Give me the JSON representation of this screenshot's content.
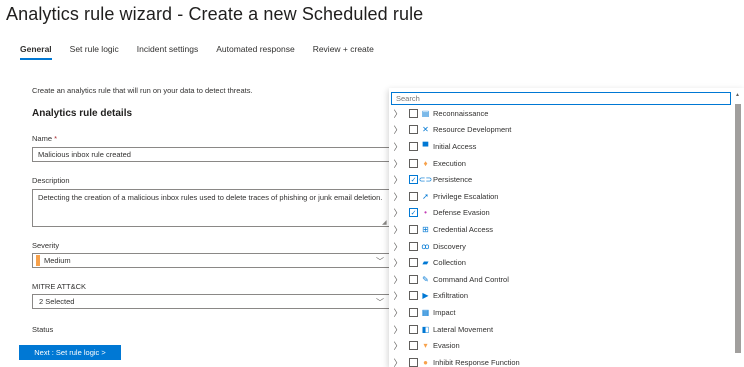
{
  "page": {
    "title": "Analytics rule wizard - Create a new Scheduled rule",
    "more": "···"
  },
  "tabs": [
    "General",
    "Set rule logic",
    "Incident settings",
    "Automated response",
    "Review + create"
  ],
  "form": {
    "intro": "Create an analytics rule that will run on your data to detect threats.",
    "section_title": "Analytics rule details",
    "name_label": "Name",
    "required_mark": "*",
    "name_value": "Malicious inbox rule created",
    "description_label": "Description",
    "description_value": "Detecting the creation of a malicious inbox rules used to delete traces of phishing or junk email deletion.",
    "severity_label": "Severity",
    "severity_value": "Medium",
    "mitre_label": "MITRE ATT&CK",
    "mitre_value": "2 Selected",
    "status_label": "Status",
    "next_button": "Next : Set rule logic >"
  },
  "dropdown": {
    "search_placeholder": "Search",
    "items": [
      {
        "label": "Reconnaissance",
        "checked": false,
        "icon": "reconnaissance-icon",
        "glyph": "▤",
        "color": "#0078d4"
      },
      {
        "label": "Resource Development",
        "checked": false,
        "icon": "resource-development-icon",
        "glyph": "✕",
        "color": "#0078d4"
      },
      {
        "label": "Initial Access",
        "checked": false,
        "icon": "initial-access-icon",
        "glyph": "▀",
        "color": "#0078d4"
      },
      {
        "label": "Execution",
        "checked": false,
        "icon": "execution-icon",
        "glyph": "♦",
        "color": "#f7a14b"
      },
      {
        "label": "Persistence",
        "checked": true,
        "icon": "persistence-icon",
        "glyph": "⊂⊃",
        "color": "#0078d4"
      },
      {
        "label": "Privilege Escalation",
        "checked": false,
        "icon": "privilege-escalation-icon",
        "glyph": "➚",
        "color": "#0078d4"
      },
      {
        "label": "Defense Evasion",
        "checked": true,
        "icon": "defense-evasion-icon",
        "glyph": "•",
        "color": "#c239b3"
      },
      {
        "label": "Credential Access",
        "checked": false,
        "icon": "credential-access-icon",
        "glyph": "⊞",
        "color": "#0078d4"
      },
      {
        "label": "Discovery",
        "checked": false,
        "icon": "discovery-icon",
        "glyph": "ꝏ",
        "color": "#0078d4"
      },
      {
        "label": "Collection",
        "checked": false,
        "icon": "collection-icon",
        "glyph": "▰",
        "color": "#0078d4"
      },
      {
        "label": "Command And Control",
        "checked": false,
        "icon": "command-and-control-icon",
        "glyph": "✎",
        "color": "#0078d4"
      },
      {
        "label": "Exfiltration",
        "checked": false,
        "icon": "exfiltration-icon",
        "glyph": "▶",
        "color": "#0078d4"
      },
      {
        "label": "Impact",
        "checked": false,
        "icon": "impact-icon",
        "glyph": "▦",
        "color": "#0078d4"
      },
      {
        "label": "Lateral Movement",
        "checked": false,
        "icon": "lateral-movement-icon",
        "glyph": "◧",
        "color": "#0078d4"
      },
      {
        "label": "Evasion",
        "checked": false,
        "icon": "evasion-icon",
        "glyph": "▾",
        "color": "#f7a14b"
      },
      {
        "label": "Inhibit Response Function",
        "checked": false,
        "icon": "inhibit-response-function-icon",
        "glyph": "●",
        "color": "#f7a14b"
      }
    ]
  },
  "colors": {
    "accent": "#0078d4",
    "severity_medium": "#f7a14b",
    "required": "#a4262c"
  }
}
